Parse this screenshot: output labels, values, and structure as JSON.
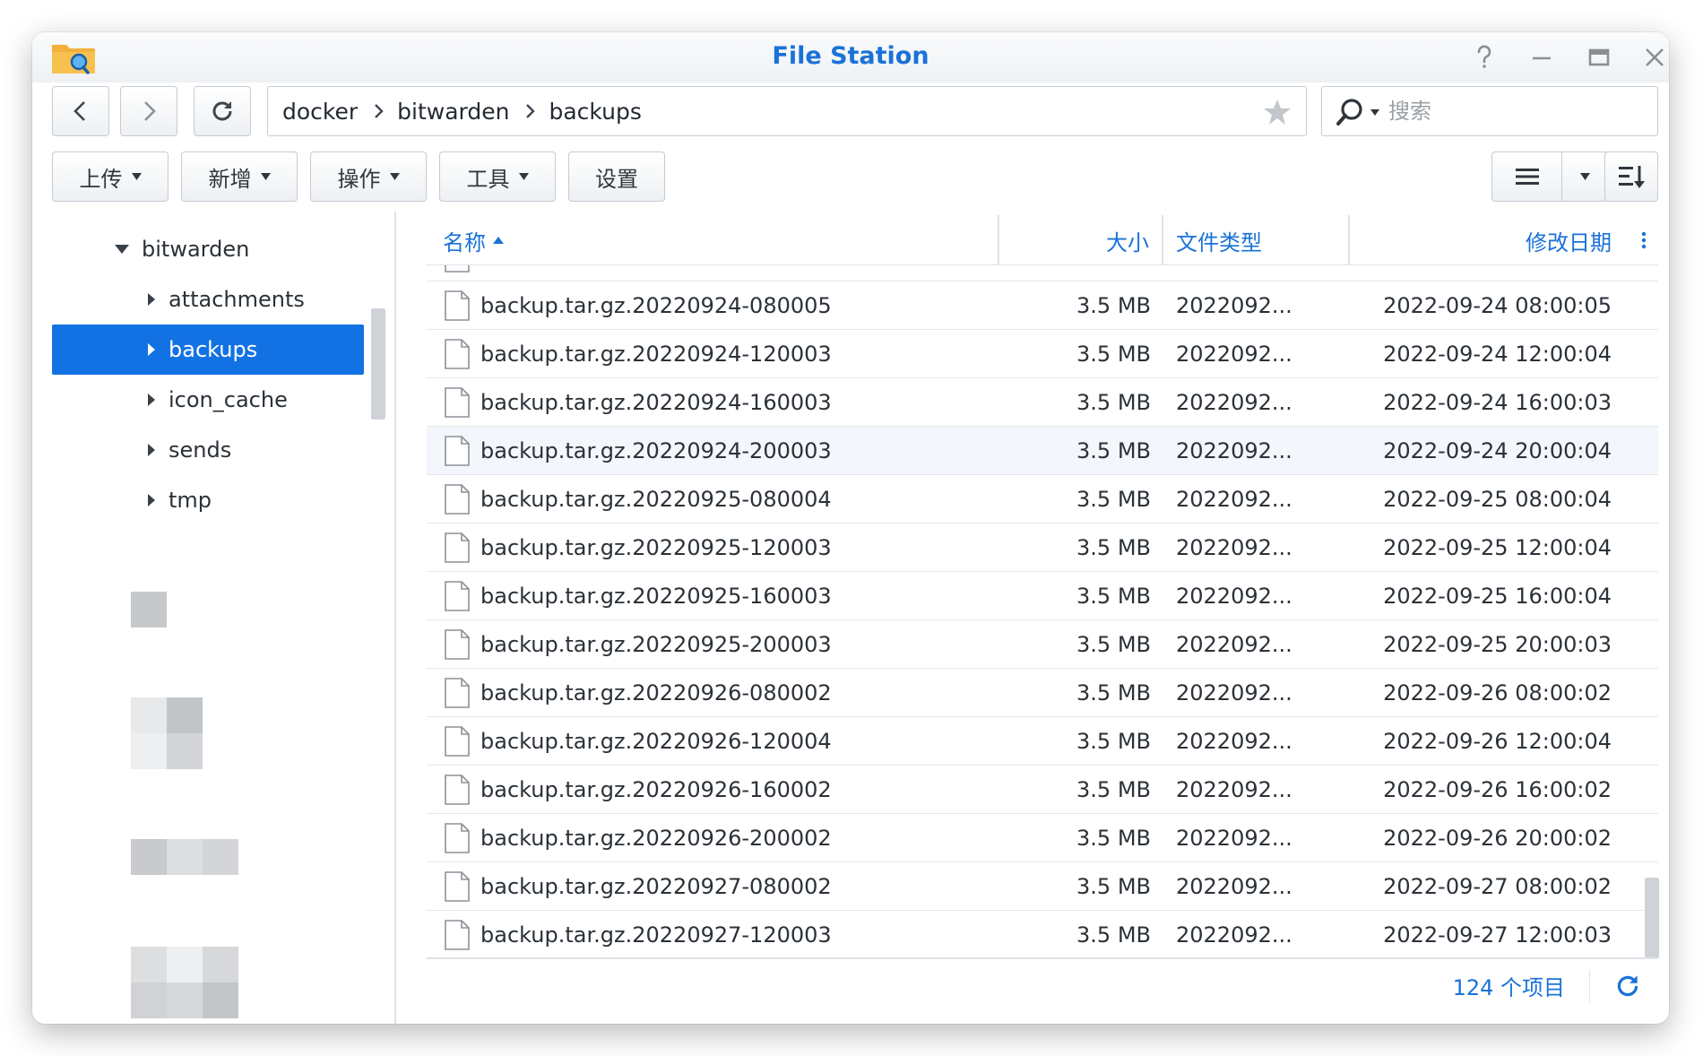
{
  "window": {
    "title": "File Station",
    "controls": [
      "help-icon",
      "minimize-icon",
      "maximize-icon",
      "close-icon"
    ]
  },
  "nav": {
    "back_icon": "chevron-left-icon",
    "forward_icon": "chevron-right-icon",
    "refresh_icon": "refresh-icon"
  },
  "path": {
    "crumbs": [
      "docker",
      "bitwarden",
      "backups"
    ],
    "favorite_icon": "star-icon"
  },
  "search": {
    "placeholder": "搜索",
    "icon": "search-icon"
  },
  "toolbar": {
    "upload": "上传",
    "create": "新增",
    "action": "操作",
    "tools": "工具",
    "settings": "设置",
    "view_icon": "list-view-icon",
    "sort_icon": "sort-icon"
  },
  "sidebar": {
    "parent": "bitwarden",
    "children": [
      "attachments",
      "backups",
      "icon_cache",
      "sends",
      "tmp"
    ],
    "selected": "backups"
  },
  "columns": {
    "name": "名称",
    "size": "大小",
    "type": "文件类型",
    "modified": "修改日期",
    "sort_direction": "ascending"
  },
  "files": [
    {
      "name": "backup.tar.gz.20220924-080005",
      "size": "3.5 MB",
      "type": "2022092...",
      "modified": "2022-09-24 08:00:05"
    },
    {
      "name": "backup.tar.gz.20220924-120003",
      "size": "3.5 MB",
      "type": "2022092...",
      "modified": "2022-09-24 12:00:04"
    },
    {
      "name": "backup.tar.gz.20220924-160003",
      "size": "3.5 MB",
      "type": "2022092...",
      "modified": "2022-09-24 16:00:03"
    },
    {
      "name": "backup.tar.gz.20220924-200003",
      "size": "3.5 MB",
      "type": "2022092...",
      "modified": "2022-09-24 20:00:04"
    },
    {
      "name": "backup.tar.gz.20220925-080004",
      "size": "3.5 MB",
      "type": "2022092...",
      "modified": "2022-09-25 08:00:04"
    },
    {
      "name": "backup.tar.gz.20220925-120003",
      "size": "3.5 MB",
      "type": "2022092...",
      "modified": "2022-09-25 12:00:04"
    },
    {
      "name": "backup.tar.gz.20220925-160003",
      "size": "3.5 MB",
      "type": "2022092...",
      "modified": "2022-09-25 16:00:04"
    },
    {
      "name": "backup.tar.gz.20220925-200003",
      "size": "3.5 MB",
      "type": "2022092...",
      "modified": "2022-09-25 20:00:03"
    },
    {
      "name": "backup.tar.gz.20220926-080002",
      "size": "3.5 MB",
      "type": "2022092...",
      "modified": "2022-09-26 08:00:02"
    },
    {
      "name": "backup.tar.gz.20220926-120004",
      "size": "3.5 MB",
      "type": "2022092...",
      "modified": "2022-09-26 12:00:04"
    },
    {
      "name": "backup.tar.gz.20220926-160002",
      "size": "3.5 MB",
      "type": "2022092...",
      "modified": "2022-09-26 16:00:02"
    },
    {
      "name": "backup.tar.gz.20220926-200002",
      "size": "3.5 MB",
      "type": "2022092...",
      "modified": "2022-09-26 20:00:02"
    },
    {
      "name": "backup.tar.gz.20220927-080002",
      "size": "3.5 MB",
      "type": "2022092...",
      "modified": "2022-09-27 08:00:02"
    },
    {
      "name": "backup.tar.gz.20220927-120003",
      "size": "3.5 MB",
      "type": "2022092...",
      "modified": "2022-09-27 12:00:03"
    }
  ],
  "footer": {
    "count": "124 个项目",
    "refresh_icon": "refresh-icon"
  },
  "colors": {
    "accent": "#1a72d8",
    "selection": "#1372e3"
  }
}
